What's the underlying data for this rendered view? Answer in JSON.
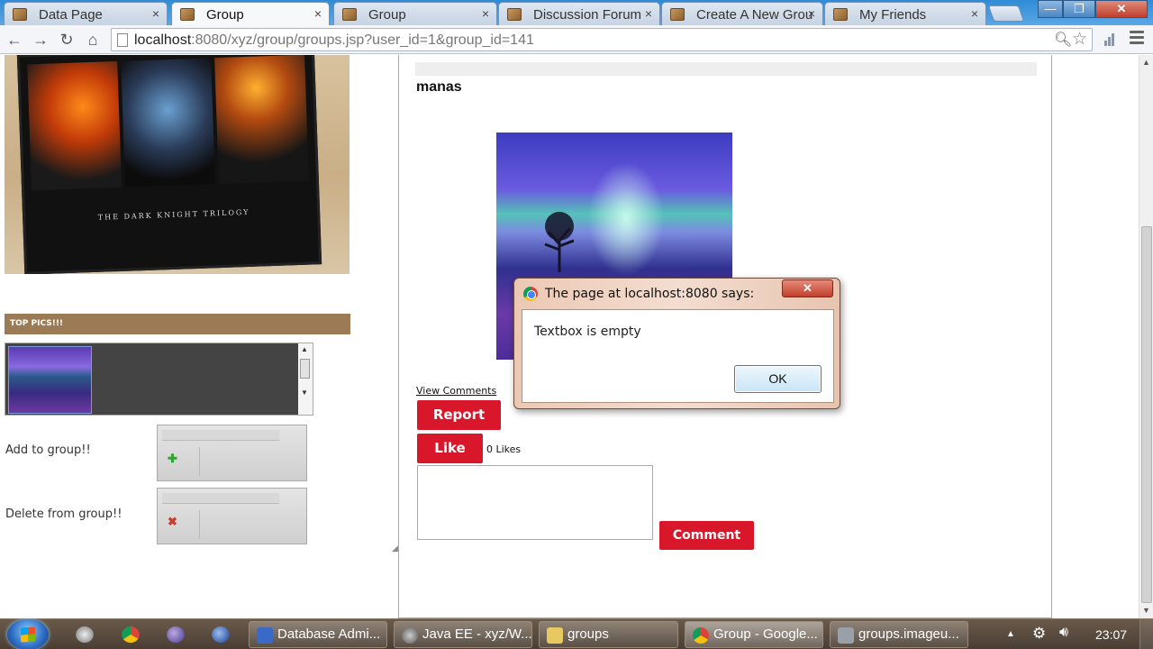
{
  "browser": {
    "tabs": [
      {
        "label": "Data Page",
        "close": "×"
      },
      {
        "label": "Group",
        "close": "×"
      },
      {
        "label": "Group",
        "close": "×"
      },
      {
        "label": "Discussion Forum",
        "close": "×"
      },
      {
        "label": "Create A New Grou",
        "close": "×"
      },
      {
        "label": "My Friends",
        "close": "×"
      }
    ],
    "window_controls": {
      "minimize": "—",
      "maximize": "❐",
      "close": "✕"
    },
    "nav": {
      "back": "←",
      "forward": "→",
      "reload": "↻",
      "home": "⌂"
    },
    "url_host": "localhost",
    "url_rest": ":8080/xyz/group/groups.jsp?user_id=1&group_id=141"
  },
  "sidebar": {
    "poster_caption": "THE DARK KNIGHT TRILOGY",
    "top_pics_label": "TOP PICS!!!",
    "add_label": "Add to group!!",
    "add_icon": "✚",
    "delete_label": "Delete from group!!",
    "delete_icon": "✖"
  },
  "post": {
    "username": "manas",
    "view_comments": "View Comments",
    "report_label": "Report",
    "like_label": "Like",
    "likes_count": "0 Likes",
    "comment_label": "Comment"
  },
  "dialog": {
    "title": "The page at localhost:8080 says:",
    "message": "Textbox is empty",
    "ok_label": "OK",
    "close": "✕"
  },
  "taskbar": {
    "tasks": [
      {
        "label": "Database Admi..."
      },
      {
        "label": "Java EE - xyz/W..."
      },
      {
        "label": "groups"
      },
      {
        "label": "Group - Google..."
      },
      {
        "label": "groups.imageu..."
      }
    ],
    "clock": "23:07"
  },
  "colors": {
    "accent_red": "#d8182a",
    "header_brown": "#9b7b55",
    "taskbar": "#5a4a3c"
  }
}
